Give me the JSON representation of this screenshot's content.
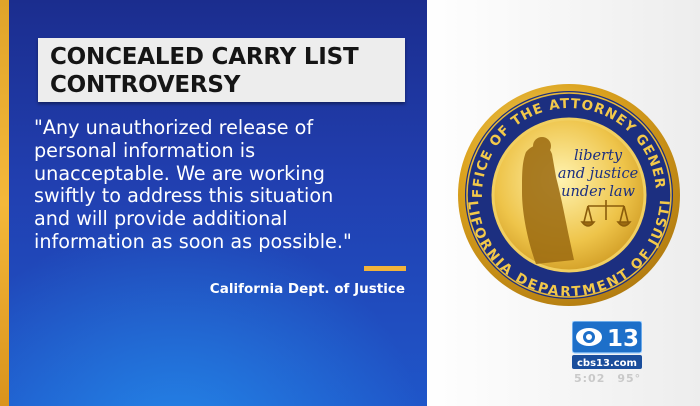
{
  "headline": {
    "line1": "CONCEALED CARRY LIST",
    "line2": "CONTROVERSY"
  },
  "quote": {
    "lines": [
      "\"Any unauthorized release of",
      "personal information is",
      "unacceptable. We are working",
      "swiftly to address this situation",
      "and will provide additional",
      "information as soon as possible.\""
    ]
  },
  "attribution": "California Dept. of Justice",
  "seal": {
    "top_text": "OFFICE OF THE ATTORNEY GENERAL",
    "bottom_text": "CALIFORNIA DEPARTMENT OF JUSTICE",
    "motto_line1": "liberty",
    "motto_line2": "and justice",
    "motto_line3": "under law"
  },
  "station": {
    "number": "13",
    "site": "cbs13.com",
    "time": "5:02",
    "temperature": "95°"
  },
  "colors": {
    "panel_blue": "#213fb0",
    "accent_gold": "#f2b33a",
    "seal_navy": "#1c2f80",
    "seal_gold": "#d9a520"
  }
}
